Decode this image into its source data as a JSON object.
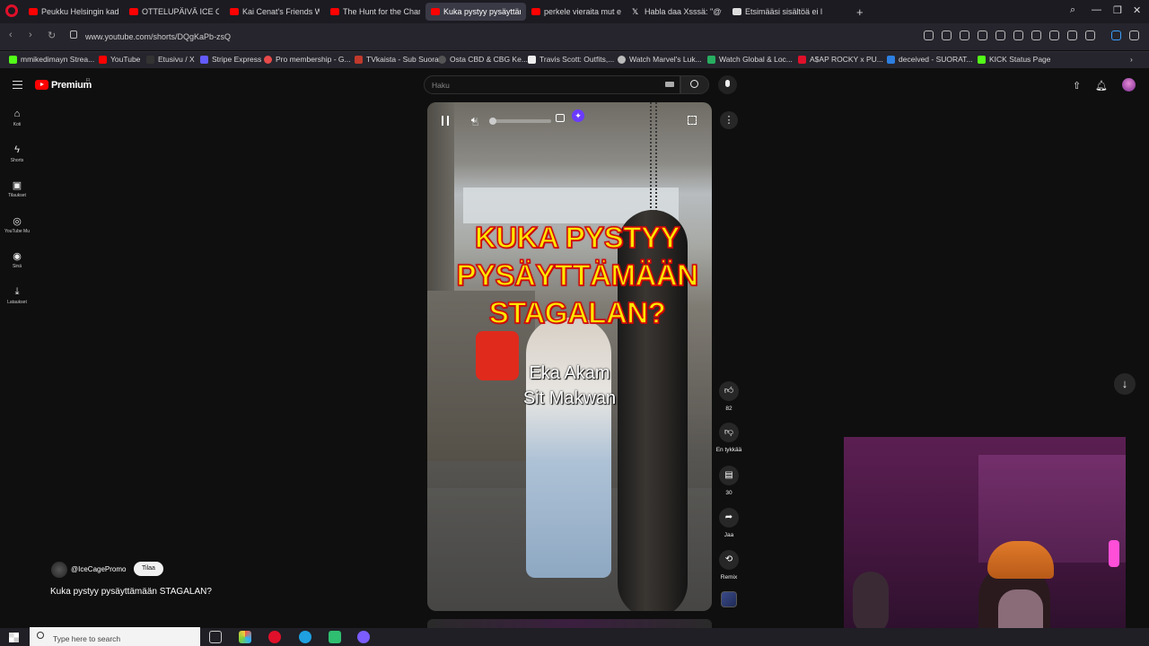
{
  "browser": {
    "tabs": [
      {
        "label": "Peukku Helsingin kaduilla",
        "favicon": "youtube",
        "active": false
      },
      {
        "label": "OTTELUPÄIVÄ ICE CAGE 5",
        "favicon": "youtube",
        "active": false
      },
      {
        "label": "Kai Cenat's Friends Will Be",
        "favicon": "youtube",
        "active": false
      },
      {
        "label": "The Hunt for the Charlie K",
        "favicon": "youtube",
        "active": false
      },
      {
        "label": "Kuka pystyy pysäyttämä",
        "favicon": "youtube",
        "active": true
      },
      {
        "label": "perkele vieraita mut ei vim",
        "favicon": "youtube",
        "active": false
      },
      {
        "label": "Habla daa Xsssä: \"@tarzan",
        "favicon": "x",
        "active": false
      },
      {
        "label": "Etsimääsi sisältöä ei löyty",
        "favicon": "generic",
        "active": false
      }
    ],
    "url": "www.youtube.com/shorts/DQgKaPb-zsQ",
    "bookmarks": [
      {
        "label": "mmikedimayn Strea...",
        "color": "#53fc18"
      },
      {
        "label": "YouTube",
        "color": "#ff0000"
      },
      {
        "label": "Etusivu / X",
        "color": "#333333"
      },
      {
        "label": "Stripe Express",
        "color": "#635bff"
      },
      {
        "label": "Pro membership - G...",
        "color": "#e84a4a"
      },
      {
        "label": "TVkaista - Sub Suora",
        "color": "#c0392b"
      },
      {
        "label": "Osta CBD & CBG Ke...",
        "color": "#555555"
      },
      {
        "label": "Travis Scott: Outfits,...",
        "color": "#eeeeee"
      },
      {
        "label": "Watch Marvel's Luk...",
        "color": "#bbbbbb"
      },
      {
        "label": "Watch Global & Loc...",
        "color": "#27ae60"
      },
      {
        "label": "A$AP ROCKY x PU...",
        "color": "#e0102a"
      },
      {
        "label": "deceived - SUORAT...",
        "color": "#2d7fe0"
      },
      {
        "label": "KICK Status Page",
        "color": "#53fc18"
      }
    ]
  },
  "youtube": {
    "logo_text": "Premium",
    "logo_superscript": "FI",
    "search_placeholder": "Haku",
    "sidebar": [
      {
        "label": "Koti",
        "icon": "home-icon"
      },
      {
        "label": "Shorts",
        "icon": "shorts-icon"
      },
      {
        "label": "Tilaukset",
        "icon": "subscriptions-icon"
      },
      {
        "label": "YouTube Mu",
        "icon": "youtube-music-icon"
      },
      {
        "label": "Sinä",
        "icon": "you-icon"
      },
      {
        "label": "Lataukset",
        "icon": "downloads-icon"
      }
    ],
    "short": {
      "overlay_title_lines": [
        "KUKA PYSTYY",
        "PYSÄYTTÄMÄÄN",
        "STAGALAN?"
      ],
      "caption_lines": [
        "Eka Akam",
        "Sit Makwan"
      ],
      "channel": "@IceCagePromo",
      "subscribe_label": "Tilaa",
      "title": "Kuka pystyy pysäyttämään STAGALAN?"
    },
    "actions": {
      "like_count": "82",
      "dislike_label": "En tykkää",
      "comments_count": "30",
      "share_label": "Jaa",
      "remix_label": "Remix"
    },
    "colors": {
      "brand": "#ff0000",
      "overlay_text": "#ffe600",
      "overlay_outline": "#d10a0a"
    }
  },
  "taskbar": {
    "search_placeholder": "Type here to search"
  }
}
